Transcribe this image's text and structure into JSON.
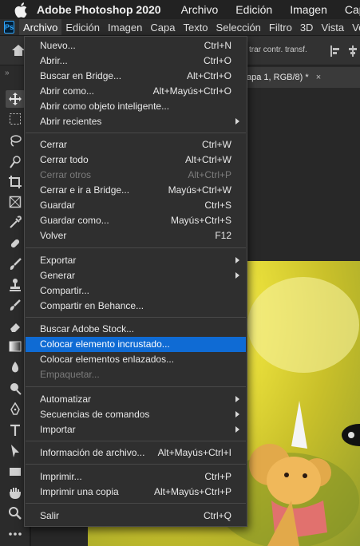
{
  "mac_menu": {
    "app_name": "Adobe Photoshop 2020",
    "items": [
      "Archivo",
      "Edición",
      "Imagen",
      "Capa"
    ]
  },
  "ps_menu": {
    "logo": "Ps",
    "items": [
      "Archivo",
      "Edición",
      "Imagen",
      "Capa",
      "Texto",
      "Selección",
      "Filtro",
      "3D",
      "Vista",
      "Ven"
    ]
  },
  "options_bar": {
    "text": "trar contr. transf."
  },
  "toolbar": {
    "grip": "»"
  },
  "document": {
    "tab_title": "apa 1, RGB/8) *",
    "tab_close": "×"
  },
  "archivo_menu": {
    "items": [
      {
        "label": "Nuevo...",
        "shortcut": "Ctrl+N"
      },
      {
        "label": "Abrir...",
        "shortcut": "Ctrl+O"
      },
      {
        "label": "Buscar en Bridge...",
        "shortcut": "Alt+Ctrl+O"
      },
      {
        "label": "Abrir como...",
        "shortcut": "Alt+Mayús+Ctrl+O"
      },
      {
        "label": "Abrir como objeto inteligente...",
        "shortcut": ""
      },
      {
        "label": "Abrir recientes",
        "shortcut": ""
      },
      {
        "label": "Cerrar",
        "shortcut": "Ctrl+W"
      },
      {
        "label": "Cerrar todo",
        "shortcut": "Alt+Ctrl+W"
      },
      {
        "label": "Cerrar otros",
        "shortcut": "Alt+Ctrl+P"
      },
      {
        "label": "Cerrar e ir a Bridge...",
        "shortcut": "Mayús+Ctrl+W"
      },
      {
        "label": "Guardar",
        "shortcut": "Ctrl+S"
      },
      {
        "label": "Guardar como...",
        "shortcut": "Mayús+Ctrl+S"
      },
      {
        "label": "Volver",
        "shortcut": "F12"
      },
      {
        "label": "Exportar",
        "shortcut": ""
      },
      {
        "label": "Generar",
        "shortcut": ""
      },
      {
        "label": "Compartir...",
        "shortcut": ""
      },
      {
        "label": "Compartir en Behance...",
        "shortcut": ""
      },
      {
        "label": "Buscar Adobe Stock...",
        "shortcut": ""
      },
      {
        "label": "Colocar elemento incrustado...",
        "shortcut": ""
      },
      {
        "label": "Colocar elementos enlazados...",
        "shortcut": ""
      },
      {
        "label": "Empaquetar...",
        "shortcut": ""
      },
      {
        "label": "Automatizar",
        "shortcut": ""
      },
      {
        "label": "Secuencias de comandos",
        "shortcut": ""
      },
      {
        "label": "Importar",
        "shortcut": ""
      },
      {
        "label": "Información de archivo...",
        "shortcut": "Alt+Mayús+Ctrl+I"
      },
      {
        "label": "Imprimir...",
        "shortcut": "Ctrl+P"
      },
      {
        "label": "Imprimir una copia",
        "shortcut": "Alt+Mayús+Ctrl+P"
      },
      {
        "label": "Salir",
        "shortcut": "Ctrl+Q"
      }
    ]
  },
  "colors": {
    "menu_bg": "#2f2f2f",
    "highlight": "#0f6bd4",
    "disabled_text": "#7c7c7c",
    "ps_logo_blue": "#31a8ff"
  }
}
